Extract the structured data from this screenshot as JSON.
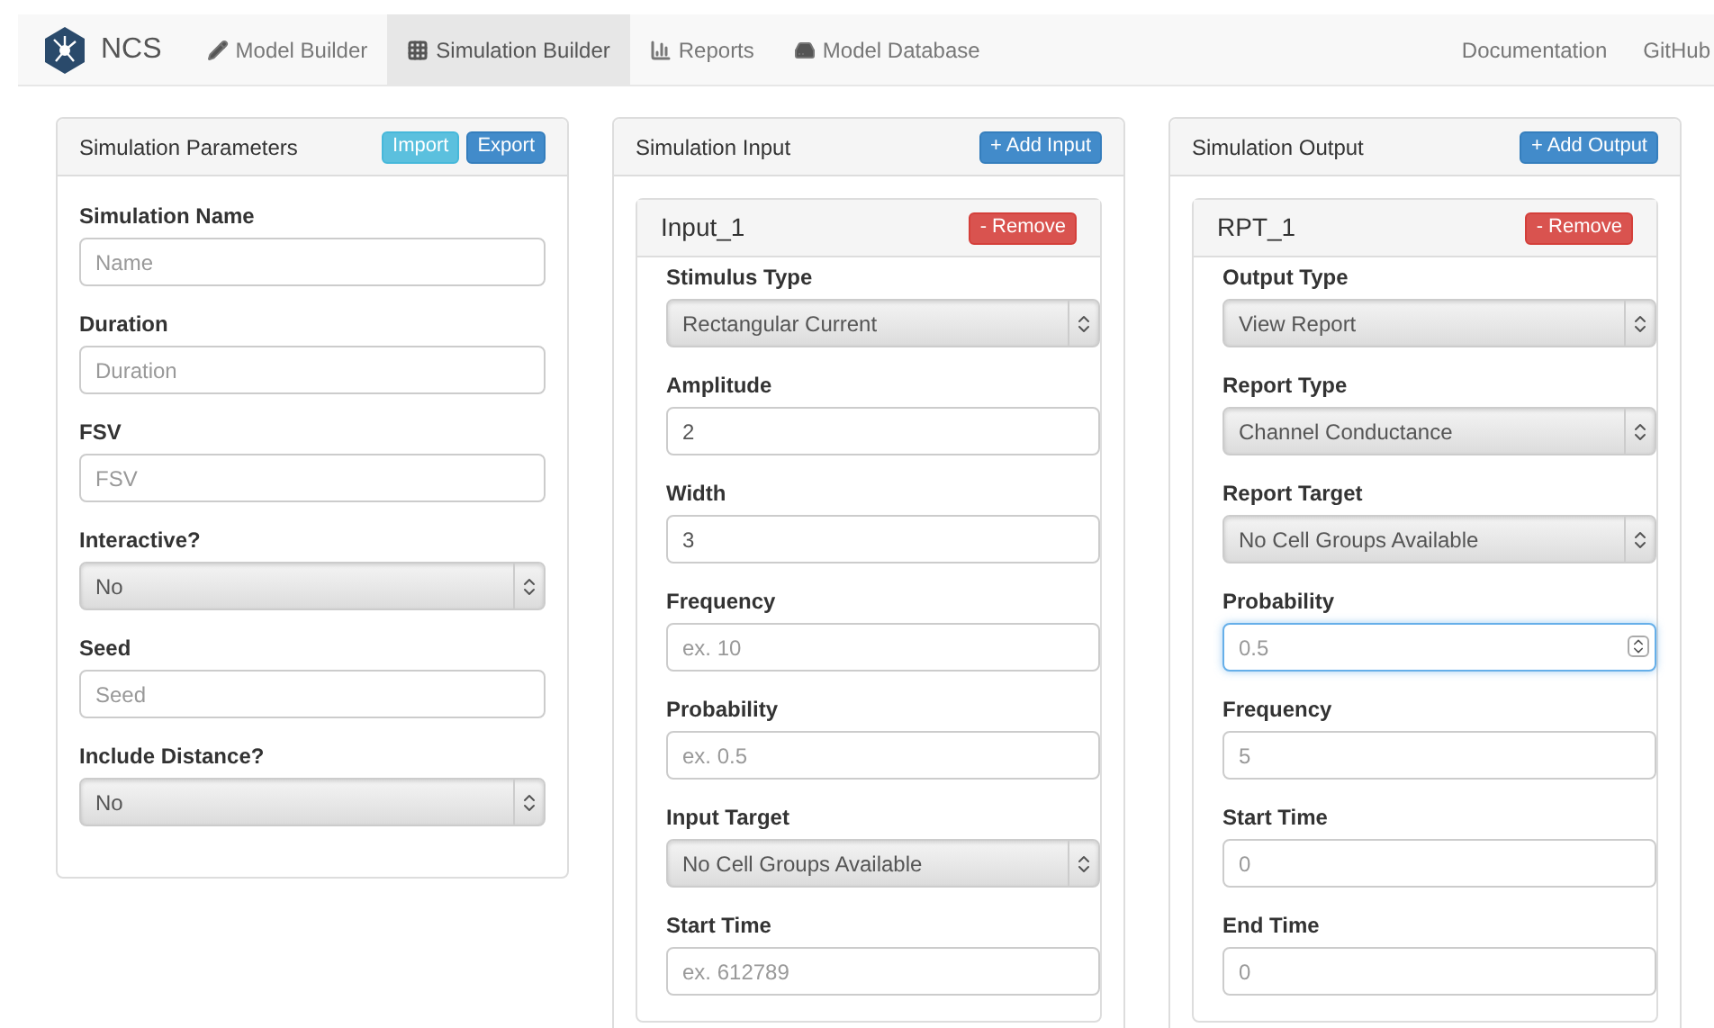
{
  "navbar": {
    "brand": "NCS",
    "items": [
      {
        "label": "Model Builder",
        "selected": false
      },
      {
        "label": "Simulation Builder",
        "selected": true
      },
      {
        "label": "Reports",
        "selected": false
      },
      {
        "label": "Model Database",
        "selected": false
      }
    ],
    "right_items": [
      "Documentation",
      "GitHub"
    ]
  },
  "parameters": {
    "title": "Simulation Parameters",
    "buttons": [
      {
        "label": "Import",
        "kind": "info"
      },
      {
        "label": "Export",
        "kind": "primary"
      }
    ],
    "fields": [
      {
        "label": "Simulation Name",
        "kind": "text",
        "placeholder": "Name"
      },
      {
        "label": "Duration",
        "kind": "text",
        "placeholder": "Duration"
      },
      {
        "label": "FSV",
        "kind": "text",
        "placeholder": "FSV"
      },
      {
        "label": "Interactive?",
        "kind": "select",
        "value": "No"
      },
      {
        "label": "Seed",
        "kind": "text",
        "placeholder": "Seed"
      },
      {
        "label": "Include Distance?",
        "kind": "select",
        "value": "No"
      }
    ]
  },
  "input": {
    "title": "Simulation Input",
    "add_button": "+ Add Input",
    "items": [
      {
        "name": "Input_1",
        "remove_button": "- Remove",
        "fields": [
          {
            "label": "Stimulus Type",
            "kind": "select",
            "value": "Rectangular Current"
          },
          {
            "label": "Amplitude",
            "kind": "text",
            "value": "2"
          },
          {
            "label": "Width",
            "kind": "text",
            "value": "3"
          },
          {
            "label": "Frequency",
            "kind": "text",
            "placeholder": "ex. 10"
          },
          {
            "label": "Probability",
            "kind": "text",
            "placeholder": "ex. 0.5"
          },
          {
            "label": "Input Target",
            "kind": "select",
            "value": "No Cell Groups Available"
          },
          {
            "label": "Start Time",
            "kind": "text",
            "placeholder": "ex. 612789"
          }
        ]
      }
    ]
  },
  "output": {
    "title": "Simulation Output",
    "add_button": "+ Add Output",
    "items": [
      {
        "name": "RPT_1",
        "remove_button": "- Remove",
        "fields": [
          {
            "label": "Output Type",
            "kind": "select",
            "value": "View Report"
          },
          {
            "label": "Report Type",
            "kind": "select",
            "value": "Channel Conductance"
          },
          {
            "label": "Report Target",
            "kind": "select",
            "value": "No Cell Groups Available"
          },
          {
            "label": "Probability",
            "kind": "number",
            "placeholder": "0.5",
            "focused": true
          },
          {
            "label": "Frequency",
            "kind": "text",
            "placeholder": "5"
          },
          {
            "label": "Start Time",
            "kind": "text",
            "placeholder": "0"
          },
          {
            "label": "End Time",
            "kind": "text",
            "placeholder": "0"
          }
        ]
      }
    ]
  }
}
